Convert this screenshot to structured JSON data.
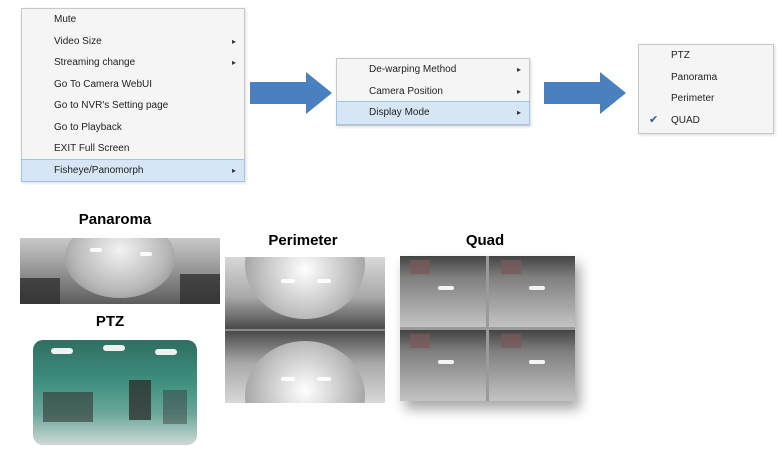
{
  "context_menu": {
    "items": [
      {
        "label": "Mute",
        "submenu": false
      },
      {
        "label": "Video Size",
        "submenu": true
      },
      {
        "label": "Streaming change",
        "submenu": true
      },
      {
        "label": "Go To Camera WebUI",
        "submenu": false
      },
      {
        "label": "Go to NVR's Setting page",
        "submenu": false
      },
      {
        "label": "Go to Playback",
        "submenu": false
      },
      {
        "label": "EXIT Full Screen",
        "submenu": false
      },
      {
        "label": "Fisheye/Panomorph",
        "submenu": true,
        "highlighted": true
      }
    ]
  },
  "fisheye_menu": {
    "items": [
      {
        "label": "De-warping Method",
        "submenu": true
      },
      {
        "label": "Camera Position",
        "submenu": true
      },
      {
        "label": "Display Mode",
        "submenu": true,
        "highlighted": true
      }
    ]
  },
  "display_mode_menu": {
    "items": [
      {
        "label": "PTZ"
      },
      {
        "label": "Panorama"
      },
      {
        "label": "Perimeter"
      },
      {
        "label": "QUAD",
        "checked": true
      }
    ]
  },
  "previews": {
    "panorama_label": "Panaroma",
    "ptz_label": "PTZ",
    "perimeter_label": "Perimeter",
    "quad_label": "Quad"
  },
  "colors": {
    "arrow": "#4a7fc0",
    "highlight": "#d6e6f7"
  },
  "icons": {
    "submenu": "chevron-right-icon",
    "checked": "checkmark-icon",
    "flow": "arrow-right-icon"
  }
}
